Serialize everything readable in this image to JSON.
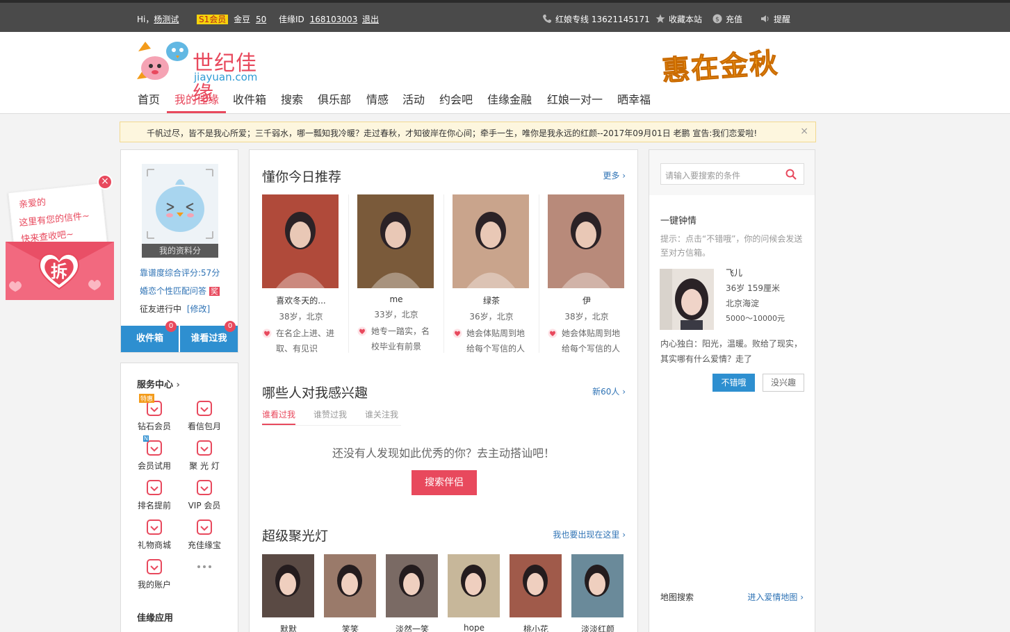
{
  "topbar": {
    "greeting": "Hi，",
    "username": "杨测试",
    "vip_label": "S1会员",
    "gold_label": "金豆",
    "gold_value": "50",
    "id_label": "佳缘ID",
    "id_value": "168103003",
    "logout": "退出",
    "hotline": "红娘专线 13621145171",
    "bookmark": "收藏本站",
    "recharge": "充值",
    "remind": "提醒"
  },
  "header": {
    "logo_text": "世纪佳缘",
    "logo_sub": "jiayuan.com",
    "promo": "惠在金秋",
    "nav": [
      "首页",
      "我的佳缘",
      "收件箱",
      "搜索",
      "俱乐部",
      "情感",
      "活动",
      "约会吧",
      "佳缘金融",
      "红娘一对一",
      "晒幸福"
    ]
  },
  "notice": {
    "text": "千帆过尽，皆不是我心所爱；三千弱水，哪一瓢知我冷暖？走过春秋，才知彼岸在你心间；牵手一生，唯你是我永远的红颜--2017年09月01日   老鹏   宣告:我们恋爱啦!",
    "close": "×"
  },
  "letter": {
    "line1": "亲爱的",
    "line2": "这里有您的信件~",
    "line3": "快来查收吧~",
    "open_label": "拆",
    "close": "×"
  },
  "profile": {
    "avatar_label": "我的资料分",
    "score": "靠谱度综合评分:57分",
    "quiz": "婚恋个性匹配问答",
    "quiz_badge": "奖",
    "status": "征友进行中",
    "status_edit": "[修改]",
    "inbox_btn": "收件箱",
    "inbox_count": "0",
    "visitors_btn": "谁看过我",
    "visitors_count": "0"
  },
  "services": {
    "title": "服务中心",
    "items": [
      {
        "label": "钻石会员",
        "icon": "diamond-icon",
        "tag": "特惠"
      },
      {
        "label": "看信包月",
        "icon": "mail-icon",
        "tag": ""
      },
      {
        "label": "会员试用",
        "icon": "crown-icon",
        "tag": "N"
      },
      {
        "label": "聚 光 灯",
        "icon": "spotlight-icon",
        "tag": ""
      },
      {
        "label": "排名提前",
        "icon": "rank-up-icon",
        "tag": ""
      },
      {
        "label": "VIP 会员",
        "icon": "vip-crown-icon",
        "tag": ""
      },
      {
        "label": "礼物商城",
        "icon": "gift-icon",
        "tag": ""
      },
      {
        "label": "充佳缘宝",
        "icon": "wallet-icon",
        "tag": ""
      },
      {
        "label": "我的账户",
        "icon": "account-icon",
        "tag": ""
      },
      {
        "label": "···",
        "icon": "more-icon",
        "tag": ""
      }
    ],
    "apps_title": "佳缘应用"
  },
  "recommend": {
    "title": "懂你今日推荐",
    "more": "更多",
    "items": [
      {
        "name": "喜欢冬天的...",
        "info": "38岁，北京",
        "desc": "在名企上进、进取、有见识",
        "color": "#b04a3a"
      },
      {
        "name": "me",
        "info": "33岁，北京",
        "desc": "她专一踏实，名校毕业有前景",
        "color": "#7a5a3a"
      },
      {
        "name": "绿茶",
        "info": "36岁，北京",
        "desc": "她会体贴周到地给每个写信的人",
        "color": "#c9a48c"
      },
      {
        "name": "伊",
        "info": "38岁，北京",
        "desc": "她会体贴周到地给每个写信的人",
        "color": "#b88a7a"
      }
    ]
  },
  "interest": {
    "title": "哪些人对我感兴趣",
    "new_count": "新60人",
    "tabs": [
      "谁看过我",
      "谁赞过我",
      "谁关注我"
    ],
    "empty": "还没有人发现如此优秀的你？去主动搭讪吧！",
    "search_btn": "搜索伴侣"
  },
  "spotlight": {
    "title": "超级聚光灯",
    "join": "我也要出现在这里",
    "items": [
      {
        "name": "默默",
        "color": "#5a4a44"
      },
      {
        "name": "笑笑",
        "color": "#9a7a6a"
      },
      {
        "name": "淡然一笑",
        "color": "#7a6a64"
      },
      {
        "name": "hope",
        "color": "#c7b79a"
      },
      {
        "name": "桃小花",
        "color": "#a05a4a"
      },
      {
        "name": "淡淡红颜",
        "color": "#6a8a9a"
      }
    ]
  },
  "right": {
    "search_placeholder": "请输入要搜索的条件",
    "oneclick_title": "一键钟情",
    "hint": "提示：点击“不错哦”，你的问候会发送至对方信箱。",
    "person_name": "飞儿",
    "person_age": "36岁  159厘米",
    "person_city": "北京海淀",
    "person_income": "5000～10000元",
    "quote": "内心独白：阳光，温暖。败给了现实，其实哪有什么爱情？走了",
    "like_btn": "不错哦",
    "nope_btn": "没兴趣",
    "map_title": "地图搜索",
    "map_link": "进入爱情地图"
  }
}
